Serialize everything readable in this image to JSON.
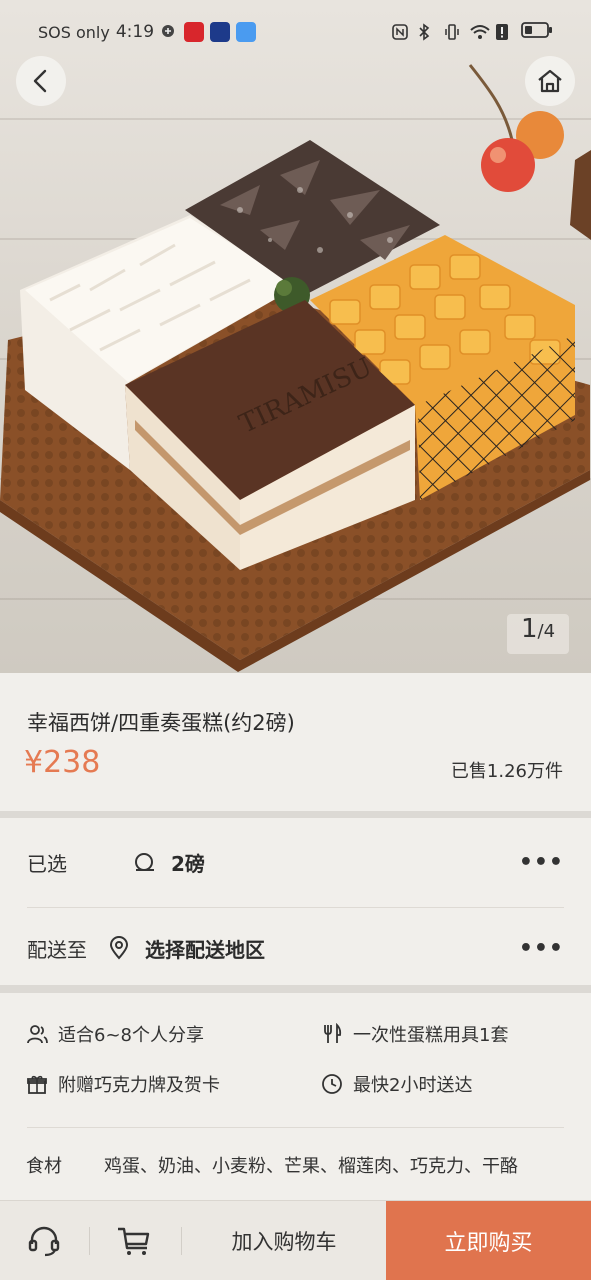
{
  "status_bar": {
    "carrier": "SOS only",
    "time": "4:19"
  },
  "hero": {
    "current_image": "1",
    "separator": "/",
    "total_images": "4",
    "cake_logo_text": "TIRAMISU"
  },
  "product": {
    "title": "幸福西饼/四重奏蛋糕(约2磅)",
    "price": "¥238",
    "sold": "已售1.26万件"
  },
  "selection": {
    "selected_label": "已选",
    "selected_value": "2磅",
    "delivery_label": "配送至",
    "delivery_value": "选择配送地区",
    "more": "•••"
  },
  "features": {
    "serves": "适合6~8个人分享",
    "tableware": "一次性蛋糕用具1套",
    "gift": "附赠巧克力牌及贺卡",
    "delivery_time": "最快2小时送达",
    "ingredients_label": "食材",
    "ingredients_value": "鸡蛋、奶油、小麦粉、芒果、榴莲肉、巧克力、干酪"
  },
  "bottom_bar": {
    "add_to_cart": "加入购物车",
    "buy_now": "立即购买"
  },
  "colors": {
    "accent": "#e0744e",
    "price": "#e57a52",
    "background": "#f1efeb"
  },
  "icons": [
    "back-icon",
    "home-icon",
    "cake-size-icon",
    "location-icon",
    "people-icon",
    "utensils-icon",
    "gift-icon",
    "clock-icon",
    "headset-icon",
    "cart-icon"
  ]
}
